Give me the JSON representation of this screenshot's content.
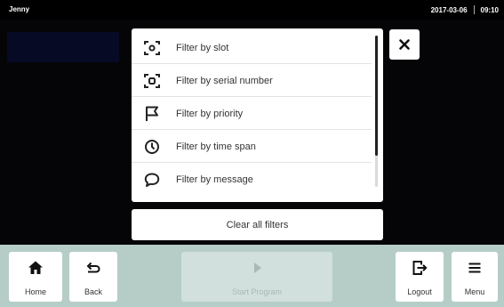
{
  "status_bar": {
    "user": "Jenny",
    "date": "2017-03-06",
    "time": "09:10"
  },
  "filters": {
    "items": [
      {
        "label": "Filter by slot",
        "icon": "slot-icon"
      },
      {
        "label": "Filter by serial number",
        "icon": "serial-number-icon"
      },
      {
        "label": "Filter by priority",
        "icon": "flag-icon"
      },
      {
        "label": "Filter by time span",
        "icon": "clock-icon"
      },
      {
        "label": "Filter by message",
        "icon": "speech-bubble-icon"
      }
    ],
    "clear_label": "Clear all filters"
  },
  "nav": {
    "home_label": "Home",
    "back_label": "Back",
    "start_label": "Start Program",
    "logout_label": "Logout",
    "menu_label": "Menu"
  },
  "colors": {
    "bottom_bar": "#b6cdc7",
    "background": "#000000",
    "panel": "#ffffff",
    "disabled": "#d1e0dc"
  }
}
